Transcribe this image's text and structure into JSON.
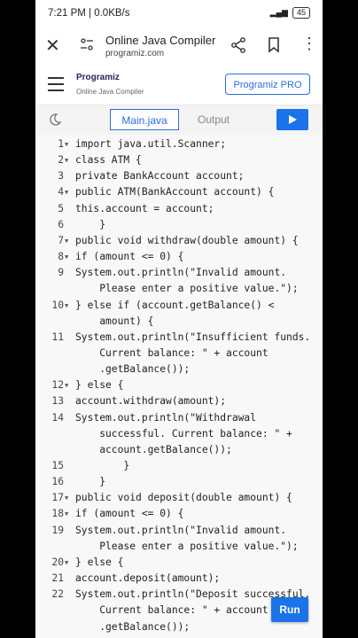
{
  "status_bar": {
    "time": "7:21 PM | 0.0KB/s",
    "battery": "45"
  },
  "browser": {
    "title": "Online Java Compiler",
    "url": "programiz.com"
  },
  "site": {
    "logo_text": "Programiz",
    "subtitle": "Online Java Compiler",
    "pro_button": "Programiz PRO"
  },
  "editor": {
    "tab_main": "Main.java",
    "tab_output": "Output",
    "run_label": "Run"
  },
  "code_lines": [
    {
      "n": "1",
      "fold": true,
      "text": "import java.util.Scanner;"
    },
    {
      "n": "2",
      "fold": true,
      "text": "class ATM {"
    },
    {
      "n": "3",
      "fold": false,
      "text": "private BankAccount account;"
    },
    {
      "n": "4",
      "fold": true,
      "text": "public ATM(BankAccount account) {"
    },
    {
      "n": "5",
      "fold": false,
      "text": "this.account = account;"
    },
    {
      "n": "6",
      "fold": false,
      "text": "    }"
    },
    {
      "n": "7",
      "fold": true,
      "text": "public void withdraw(double amount) {"
    },
    {
      "n": "8",
      "fold": true,
      "text": "if (amount <= 0) {"
    },
    {
      "n": "9",
      "fold": false,
      "text": "System.out.println(\"Invalid amount."
    },
    {
      "n": "",
      "fold": false,
      "text": "    Please enter a positive value.\");"
    },
    {
      "n": "10",
      "fold": true,
      "text": "} else if (account.getBalance() <"
    },
    {
      "n": "",
      "fold": false,
      "text": "    amount) {"
    },
    {
      "n": "11",
      "fold": false,
      "text": "System.out.println(\"Insufficient funds."
    },
    {
      "n": "",
      "fold": false,
      "text": "    Current balance: \" + account"
    },
    {
      "n": "",
      "fold": false,
      "text": "    .getBalance());"
    },
    {
      "n": "12",
      "fold": true,
      "text": "} else {"
    },
    {
      "n": "13",
      "fold": false,
      "text": "account.withdraw(amount);"
    },
    {
      "n": "14",
      "fold": false,
      "text": "System.out.println(\"Withdrawal"
    },
    {
      "n": "",
      "fold": false,
      "text": "    successful. Current balance: \" +"
    },
    {
      "n": "",
      "fold": false,
      "text": "    account.getBalance());"
    },
    {
      "n": "15",
      "fold": false,
      "text": "        }"
    },
    {
      "n": "16",
      "fold": false,
      "text": "    }"
    },
    {
      "n": "17",
      "fold": true,
      "text": "public void deposit(double amount) {"
    },
    {
      "n": "18",
      "fold": true,
      "text": "if (amount <= 0) {"
    },
    {
      "n": "19",
      "fold": false,
      "text": "System.out.println(\"Invalid amount."
    },
    {
      "n": "",
      "fold": false,
      "text": "    Please enter a positive value.\");"
    },
    {
      "n": "20",
      "fold": true,
      "text": "} else {"
    },
    {
      "n": "21",
      "fold": false,
      "text": "account.deposit(amount);"
    },
    {
      "n": "22",
      "fold": false,
      "text": "System.out.println(\"Deposit successful."
    },
    {
      "n": "",
      "fold": false,
      "text": "    Current balance: \" + account"
    },
    {
      "n": "",
      "fold": false,
      "text": "    .getBalance());"
    }
  ]
}
